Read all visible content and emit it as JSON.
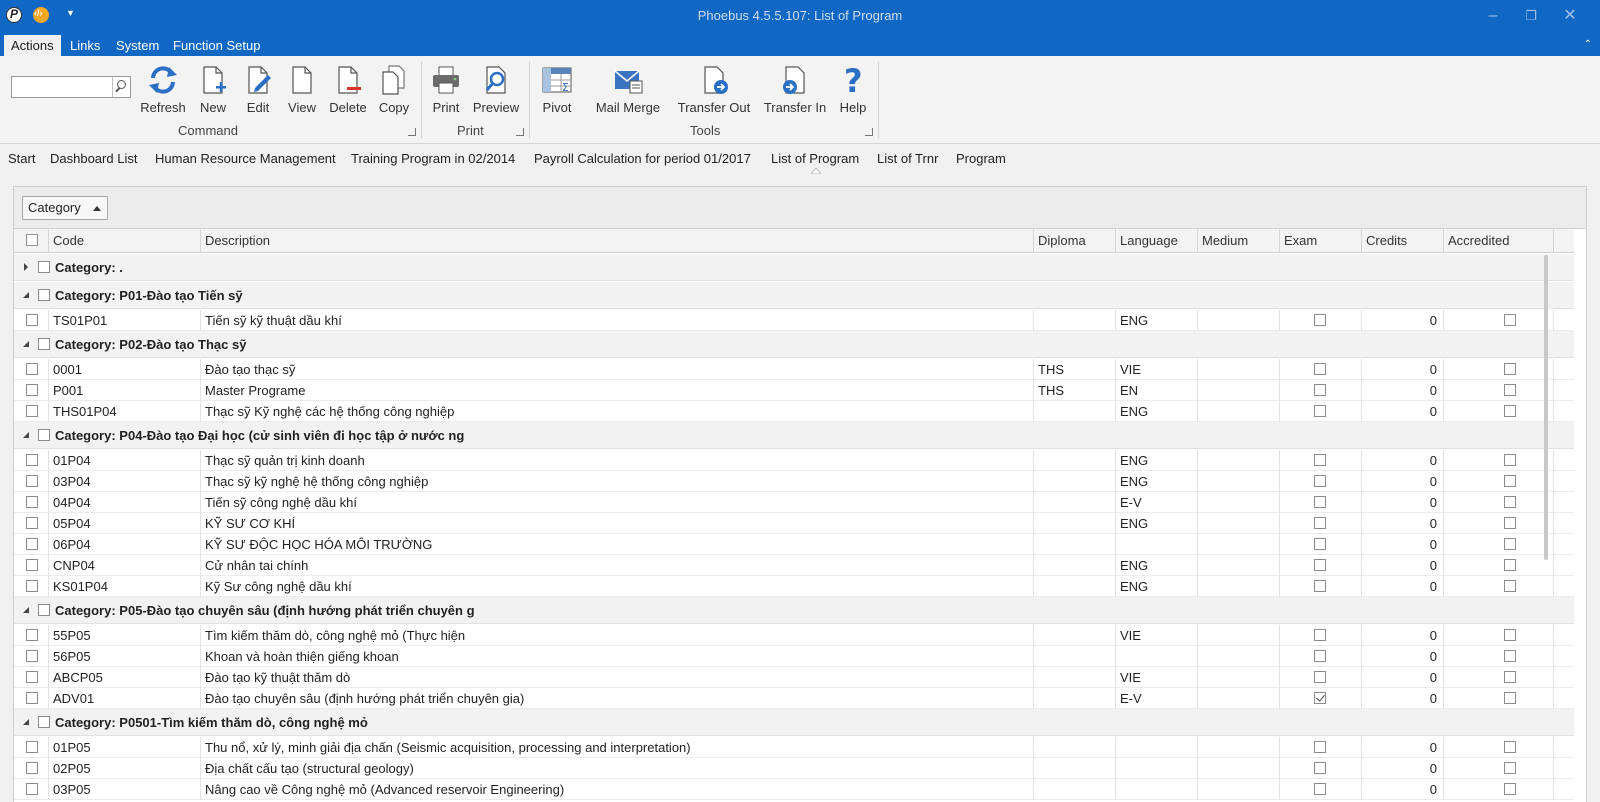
{
  "window": {
    "title": "Phoebus 4.5.5.107: List of Program"
  },
  "menu": {
    "tabs": [
      "Actions",
      "Links",
      "System",
      "Function Setup"
    ]
  },
  "ribbon": {
    "search_placeholder": "",
    "groups": [
      {
        "label": "Command",
        "buttons": [
          "Refresh",
          "New",
          "Edit",
          "View",
          "Delete",
          "Copy"
        ]
      },
      {
        "label": "Print",
        "buttons": [
          "Print",
          "Preview"
        ]
      },
      {
        "label": "Tools",
        "buttons": [
          "Pivot",
          "Mail Merge",
          "Transfer Out",
          "Transfer In",
          "Help"
        ]
      }
    ]
  },
  "doc_tabs": [
    "Start",
    "Dashboard List",
    "Human Resource Management",
    "Training Program in 02/2014",
    "Payroll Calculation for period 01/2017",
    "List of Program",
    "List of Trnr",
    "Program"
  ],
  "active_doc_tab": "List of Program",
  "grid": {
    "group_by": "Category",
    "columns": [
      "Code",
      "Description",
      "Diploma",
      "Language",
      "Medium",
      "Exam",
      "Credits",
      "Accredited"
    ],
    "groups": [
      {
        "label": "Category: .",
        "expanded": false,
        "rows": []
      },
      {
        "label": "Category: P01-Đào tạo Tiến sỹ",
        "expanded": true,
        "rows": [
          {
            "code": "TS01P01",
            "description": "Tiến sỹ kỹ thuật dầu khí",
            "diploma": "",
            "language": "ENG",
            "medium": "",
            "exam": false,
            "credits": "0",
            "accredited": false
          }
        ]
      },
      {
        "label": "Category: P02-Đào tạo Thạc sỹ",
        "expanded": true,
        "rows": [
          {
            "code": "0001",
            "description": "Đào tạo thạc sỹ",
            "diploma": "THS",
            "language": "VIE",
            "medium": "",
            "exam": false,
            "credits": "0",
            "accredited": false
          },
          {
            "code": "P001",
            "description": "Master Programe",
            "diploma": "THS",
            "language": "EN",
            "medium": "",
            "exam": false,
            "credits": "0",
            "accredited": false
          },
          {
            "code": "THS01P04",
            "description": "Thạc sỹ Kỹ nghệ các hệ thống công nghiệp",
            "diploma": "",
            "language": "ENG",
            "medium": "",
            "exam": false,
            "credits": "0",
            "accredited": false
          }
        ]
      },
      {
        "label": "Category: P04-Đào tạo Đại học (cử sinh viên đi học tập ở nước ng",
        "expanded": true,
        "rows": [
          {
            "code": "01P04",
            "description": "Thạc sỹ quản trị kinh doanh",
            "diploma": "",
            "language": "ENG",
            "medium": "",
            "exam": false,
            "credits": "0",
            "accredited": false
          },
          {
            "code": "03P04",
            "description": "Thạc sỹ kỹ nghệ hệ thống công nghiệp",
            "diploma": "",
            "language": "ENG",
            "medium": "",
            "exam": false,
            "credits": "0",
            "accredited": false
          },
          {
            "code": "04P04",
            "description": "Tiến sỹ công nghệ dầu khí",
            "diploma": "",
            "language": "E-V",
            "medium": "",
            "exam": false,
            "credits": "0",
            "accredited": false
          },
          {
            "code": "05P04",
            "description": "KỸ SƯ CƠ KHÍ",
            "diploma": "",
            "language": "ENG",
            "medium": "",
            "exam": false,
            "credits": "0",
            "accredited": false
          },
          {
            "code": "06P04",
            "description": "KỸ SƯ ĐỘC HỌC HÓA MÔI TRƯỜNG",
            "diploma": "",
            "language": "",
            "medium": "",
            "exam": false,
            "credits": "0",
            "accredited": false
          },
          {
            "code": "CNP04",
            "description": "Cử nhân tai chính",
            "diploma": "",
            "language": "ENG",
            "medium": "",
            "exam": false,
            "credits": "0",
            "accredited": false
          },
          {
            "code": "KS01P04",
            "description": "Kỹ Sư công nghệ dầu khí",
            "diploma": "",
            "language": "ENG",
            "medium": "",
            "exam": false,
            "credits": "0",
            "accredited": false
          }
        ]
      },
      {
        "label": "Category: P05-Đào tạo chuyên sâu (định hướng phát triển chuyên g",
        "expanded": true,
        "rows": [
          {
            "code": "55P05",
            "description": "Tìm kiếm thăm dò, công nghệ mỏ (Thực hiện",
            "diploma": "",
            "language": "VIE",
            "medium": "",
            "exam": false,
            "credits": "0",
            "accredited": false
          },
          {
            "code": "56P05",
            "description": "Khoan và hoàn thiện giếng khoan",
            "diploma": "",
            "language": "",
            "medium": "",
            "exam": false,
            "credits": "0",
            "accredited": false
          },
          {
            "code": "ABCP05",
            "description": "Đào tạo kỹ thuật thăm dò",
            "diploma": "",
            "language": "VIE",
            "medium": "",
            "exam": false,
            "credits": "0",
            "accredited": false
          },
          {
            "code": "ADV01",
            "description": "Đào tạo chuyên sâu (định hướng phát triển chuyên gia)",
            "diploma": "",
            "language": "E-V",
            "medium": "",
            "exam": true,
            "credits": "0",
            "accredited": false
          }
        ]
      },
      {
        "label": "Category: P0501-Tìm kiếm thăm dò, công nghệ mỏ",
        "expanded": true,
        "rows": [
          {
            "code": "01P05",
            "description": "Thu nổ, xử lý, minh giải địa chấn (Seismic acquisition, processing and interpretation)",
            "diploma": "",
            "language": "",
            "medium": "",
            "exam": false,
            "credits": "0",
            "accredited": false
          },
          {
            "code": "02P05",
            "description": "Địa chất cấu tạo (structural geology)",
            "diploma": "",
            "language": "",
            "medium": "",
            "exam": false,
            "credits": "0",
            "accredited": false
          },
          {
            "code": "03P05",
            "description": "Nâng cao về Công nghệ mỏ (Advanced reservoir Engineering)",
            "diploma": "",
            "language": "",
            "medium": "",
            "exam": false,
            "credits": "0",
            "accredited": false
          }
        ]
      }
    ]
  }
}
